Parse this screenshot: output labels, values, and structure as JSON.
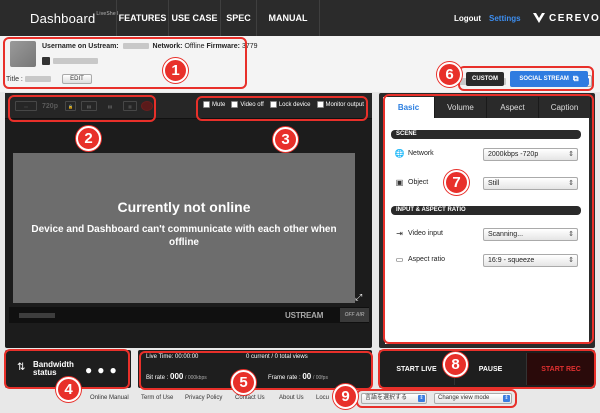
{
  "topbar": {
    "brand": "Dashboard",
    "brand_sup": "LiveShell",
    "nav": [
      "FEATURES",
      "USE CASE",
      "SPEC",
      "MANUAL"
    ],
    "logout": "Logout",
    "settings": "Settings",
    "logo": "CEREVO"
  },
  "info": {
    "username_label": "Username on Ustream:",
    "network_label": "Network:",
    "network_value": "Offline",
    "firmware_label": "Firmware:",
    "firmware_value": "3779",
    "title_label": "Title :",
    "edit": "EDIT"
  },
  "mode_buttons": {
    "custom": "CUSTOM",
    "social": "SOCIAL STREAM"
  },
  "toolbar": {
    "icons": [
      "battery-icon",
      "resolution-720p-icon",
      "lock-icon",
      "bandwidth-icon",
      "pause-icon",
      "layout-icon",
      "record-icon"
    ],
    "res_label": "720p",
    "checkboxes": [
      "Mute",
      "Video off",
      "Lock device",
      "Monitor output"
    ]
  },
  "video": {
    "headline": "Currently not online",
    "message": "Device and Dashboard can't communicate with each other when offline",
    "ustream": "USTREAM",
    "offair": "OFF AIR"
  },
  "settings_panel": {
    "tabs": [
      "Basic",
      "Volume",
      "Aspect",
      "Caption"
    ],
    "active_tab": "Basic",
    "scene_header": "SCENE",
    "network_label": "Network",
    "network_value": "2000kbps -720p",
    "object_label": "Object",
    "object_value": "Still",
    "input_header": "INPUT & ASPECT RATIO",
    "video_input_label": "Video input",
    "video_input_value": "Scanning...",
    "aspect_label": "Aspect ratio",
    "aspect_value": "16:9 - squeeze"
  },
  "bandwidth": {
    "label_line1": "Bandwidth",
    "label_line2": "status"
  },
  "stats": {
    "live_time_label": "Live Time:",
    "live_time": "00:00:00",
    "views": "0 current / 0 total views",
    "bitrate_label": "Bit rate :",
    "bitrate": "000",
    "bitrate_unit": "/ 000kbps",
    "framerate_label": "Frame rate :",
    "framerate": "00",
    "framerate_unit": "/ 00fps"
  },
  "controls": {
    "start_live": "START LIVE",
    "pause": "PAUSE",
    "start_rec": "START REC"
  },
  "footer": {
    "links": [
      "Online Manual",
      "Term of Use",
      "Privacy Policy",
      "Contact Us",
      "About Us",
      "Locu"
    ],
    "language": "言語を選択する",
    "view_mode": "Change view mode"
  },
  "callouts": [
    "1",
    "2",
    "3",
    "4",
    "5",
    "6",
    "7",
    "8",
    "9"
  ],
  "colors": {
    "accent": "#2f7ce0",
    "callout": "#e8302a",
    "rec": "#e03030"
  }
}
